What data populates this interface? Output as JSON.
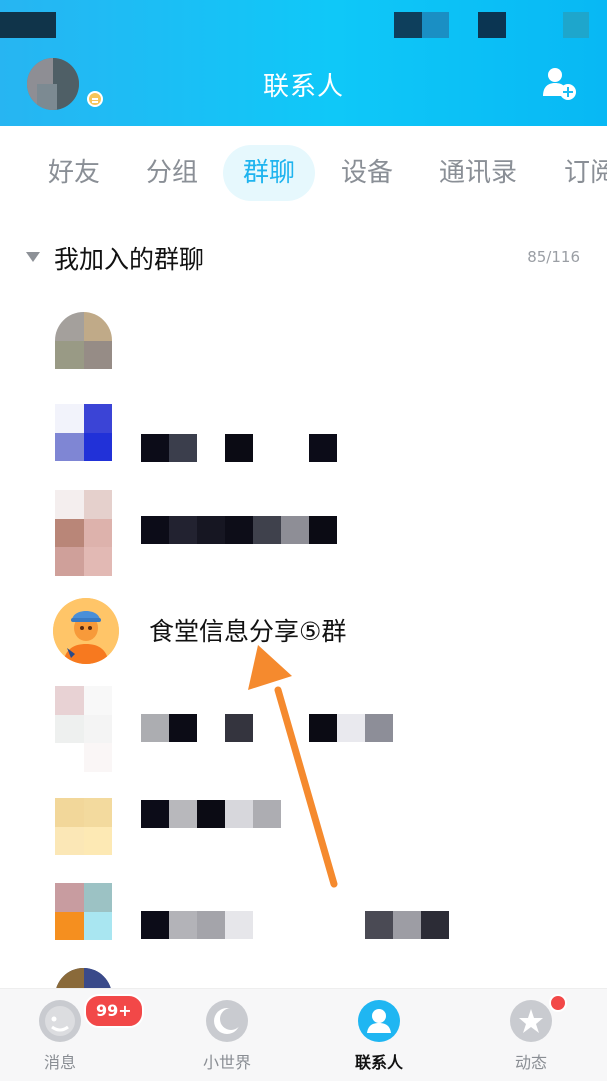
{
  "header": {
    "title": "联系人",
    "background": "#19bdf5"
  },
  "tabs": [
    {
      "label": "好友",
      "active": false
    },
    {
      "label": "分组",
      "active": false
    },
    {
      "label": "群聊",
      "active": true
    },
    {
      "label": "设备",
      "active": false
    },
    {
      "label": "通讯录",
      "active": false
    },
    {
      "label": "订阅",
      "active": false
    }
  ],
  "section": {
    "title": "我加入的群聊",
    "count": "85/116"
  },
  "groups": [
    {
      "name": "食堂信息分享⑤群"
    }
  ],
  "bottom_nav": {
    "messages": {
      "label": "消息",
      "badge": "99+"
    },
    "world": {
      "label": "小世界"
    },
    "contacts": {
      "label": "联系人"
    },
    "feed": {
      "label": "动态"
    }
  },
  "colors": {
    "accent": "#1fb4ef",
    "annotation_arrow": "#f58a2e",
    "badge_red": "#f24848"
  }
}
